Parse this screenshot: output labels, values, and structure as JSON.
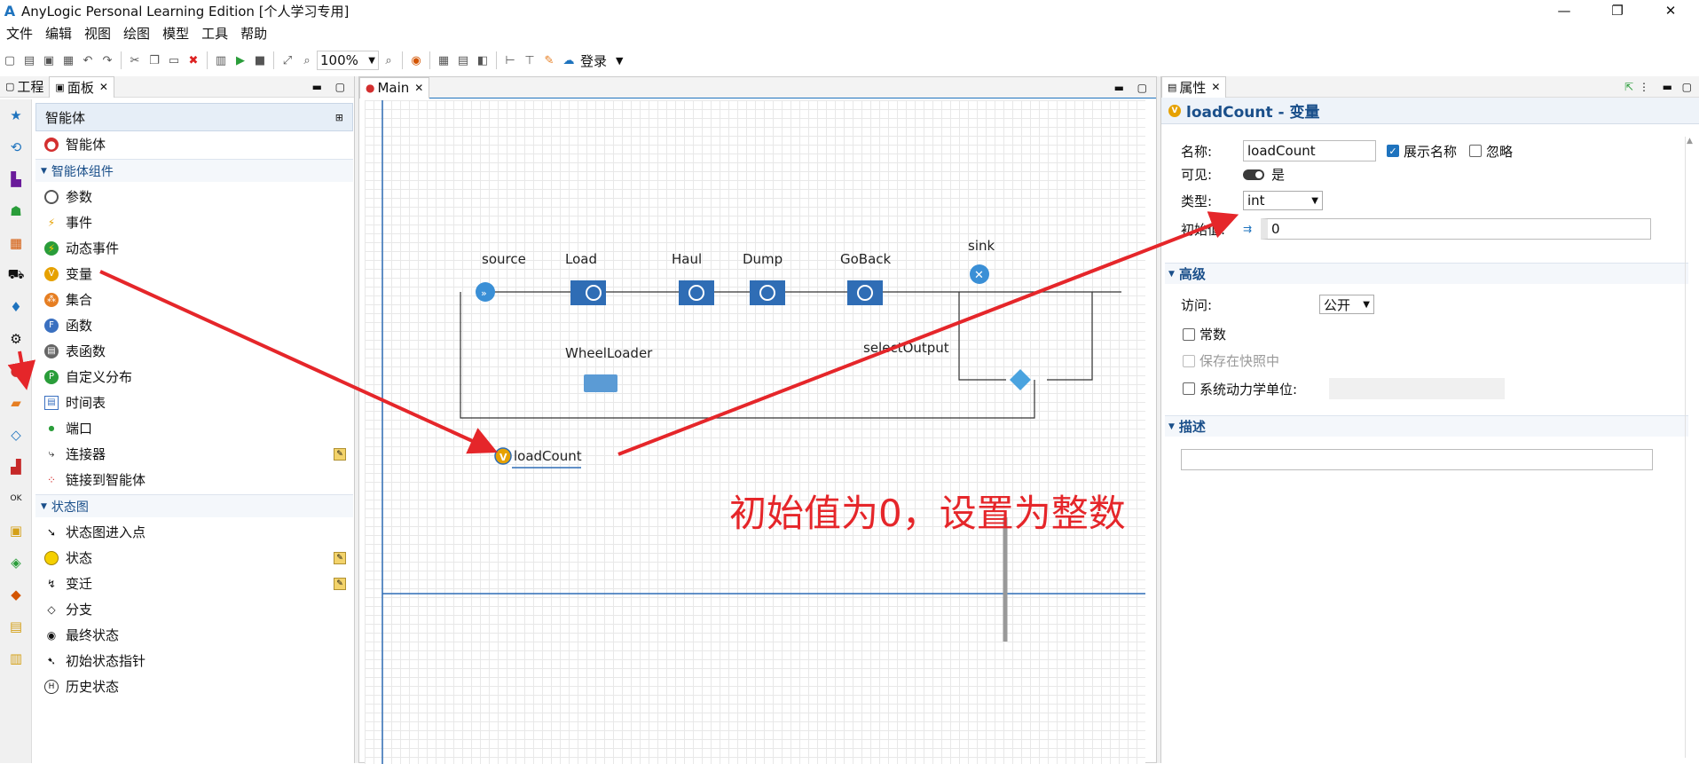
{
  "window": {
    "title": "AnyLogic Personal Learning Edition [个人学习专用]",
    "logo": "A",
    "min": "—",
    "max": "❐",
    "close": "✕"
  },
  "menu": [
    "文件",
    "编辑",
    "视图",
    "绘图",
    "模型",
    "工具",
    "帮助"
  ],
  "toolbar": {
    "zoom": "100%",
    "login": "登录"
  },
  "left": {
    "tabs": [
      {
        "label": "工程"
      },
      {
        "label": "面板"
      }
    ],
    "palette_header": "智能体",
    "top_item": "智能体",
    "section1": "智能体组件",
    "items1": [
      "参数",
      "事件",
      "动态事件",
      "变量",
      "集合",
      "函数",
      "表函数",
      "自定义分布",
      "时间表",
      "端口",
      "连接器",
      "链接到智能体"
    ],
    "section2": "状态图",
    "items2": [
      "状态图进入点",
      "状态",
      "变迁",
      "分支",
      "最终状态",
      "初始状态指针",
      "历史状态"
    ]
  },
  "editor": {
    "tab": "Main",
    "nodes": {
      "source": "source",
      "load": "Load",
      "haul": "Haul",
      "dump": "Dump",
      "goback": "GoBack",
      "sink": "sink",
      "wheelloader": "WheelLoader",
      "selectoutput": "selectOutput",
      "variable": "loadCount"
    }
  },
  "annotation": "初始值为0，设置为整数",
  "right": {
    "tab": "属性",
    "title": "loadCount - 变量",
    "name_label": "名称:",
    "name_value": "loadCount",
    "show_name": "展示名称",
    "ignore": "忽略",
    "visible_label": "可见:",
    "visible_value": "是",
    "type_label": "类型:",
    "type_value": "int",
    "init_label": "初始值:",
    "init_value": "0",
    "section_advanced": "高级",
    "access_label": "访问:",
    "access_value": "公开",
    "constant": "常数",
    "save_snapshot": "保存在快照中",
    "sd_unit": "系统动力学单位:",
    "section_desc": "描述"
  },
  "colors": {
    "accent": "#1e73be",
    "arrow": "#e5262a",
    "block": "#2f6db5"
  }
}
